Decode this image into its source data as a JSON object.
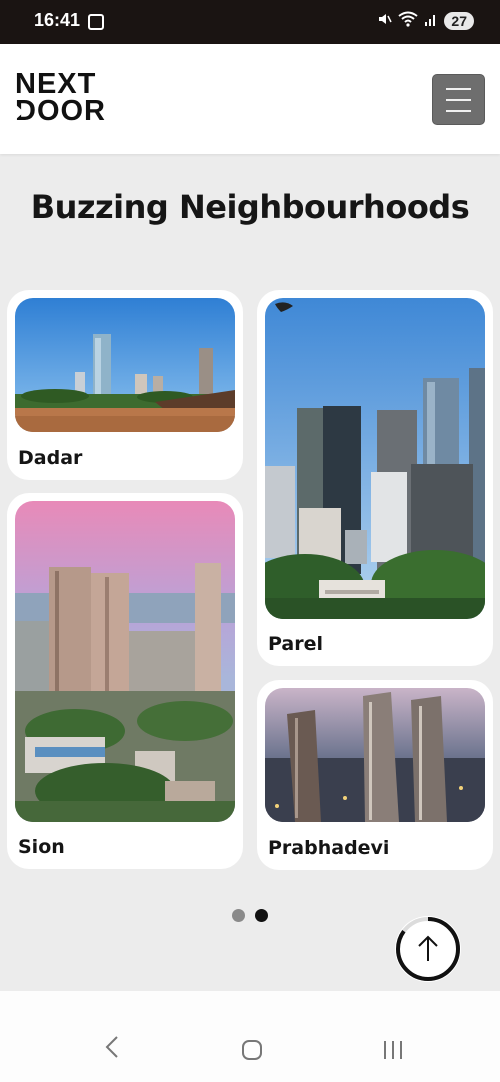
{
  "status_bar": {
    "time": "16:41",
    "battery": "27",
    "icons": [
      "screenshot-icon",
      "mute-icon",
      "wifi-icon",
      "signal-icon"
    ]
  },
  "header": {
    "logo_line1": "NEXT",
    "logo_line2": "DOOR",
    "menu_icon": "hamburger-icon"
  },
  "section": {
    "title": "Buzzing Neighbourhoods"
  },
  "cards": [
    {
      "label": "Dadar"
    },
    {
      "label": "Parel"
    },
    {
      "label": "Sion"
    },
    {
      "label": "Prabhadevi"
    }
  ],
  "pager": {
    "pages": 2,
    "active": 2,
    "active_color": "#111111",
    "inactive_color": "#8a8a8a"
  },
  "scroll_top": {
    "icon": "arrow-up-icon",
    "progress": 0.85
  },
  "nav": {
    "icons": [
      "back-icon",
      "home-icon",
      "recents-icon"
    ]
  },
  "colors": {
    "background": "#ececec",
    "card": "#ffffff",
    "text": "#151515",
    "menu_button": "#6e6e6e"
  }
}
